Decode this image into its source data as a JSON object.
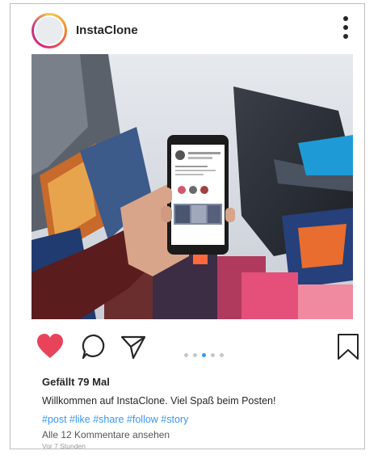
{
  "post": {
    "username": "InstaClone",
    "likes_text": "Gefällt 79 Mal",
    "caption": "Willkommen auf InstaClone. Viel Spaß beim Posten!",
    "hashtags": "#post #like #share #follow #story",
    "comments_link": "Alle 12 Kommentare ansehen",
    "time_ago": "Vor 7 Stunden",
    "liked": true
  },
  "carousel": {
    "total": 5,
    "active_index": 2
  },
  "colors": {
    "like": "#e8435a",
    "dot_active": "#3897f0",
    "hashtag": "#3897f0",
    "border": "#bdbdbd"
  },
  "icons": {
    "more": "more-vertical-icon",
    "like": "heart-icon",
    "comment": "comment-icon",
    "share": "paper-plane-icon",
    "save": "bookmark-icon"
  }
}
